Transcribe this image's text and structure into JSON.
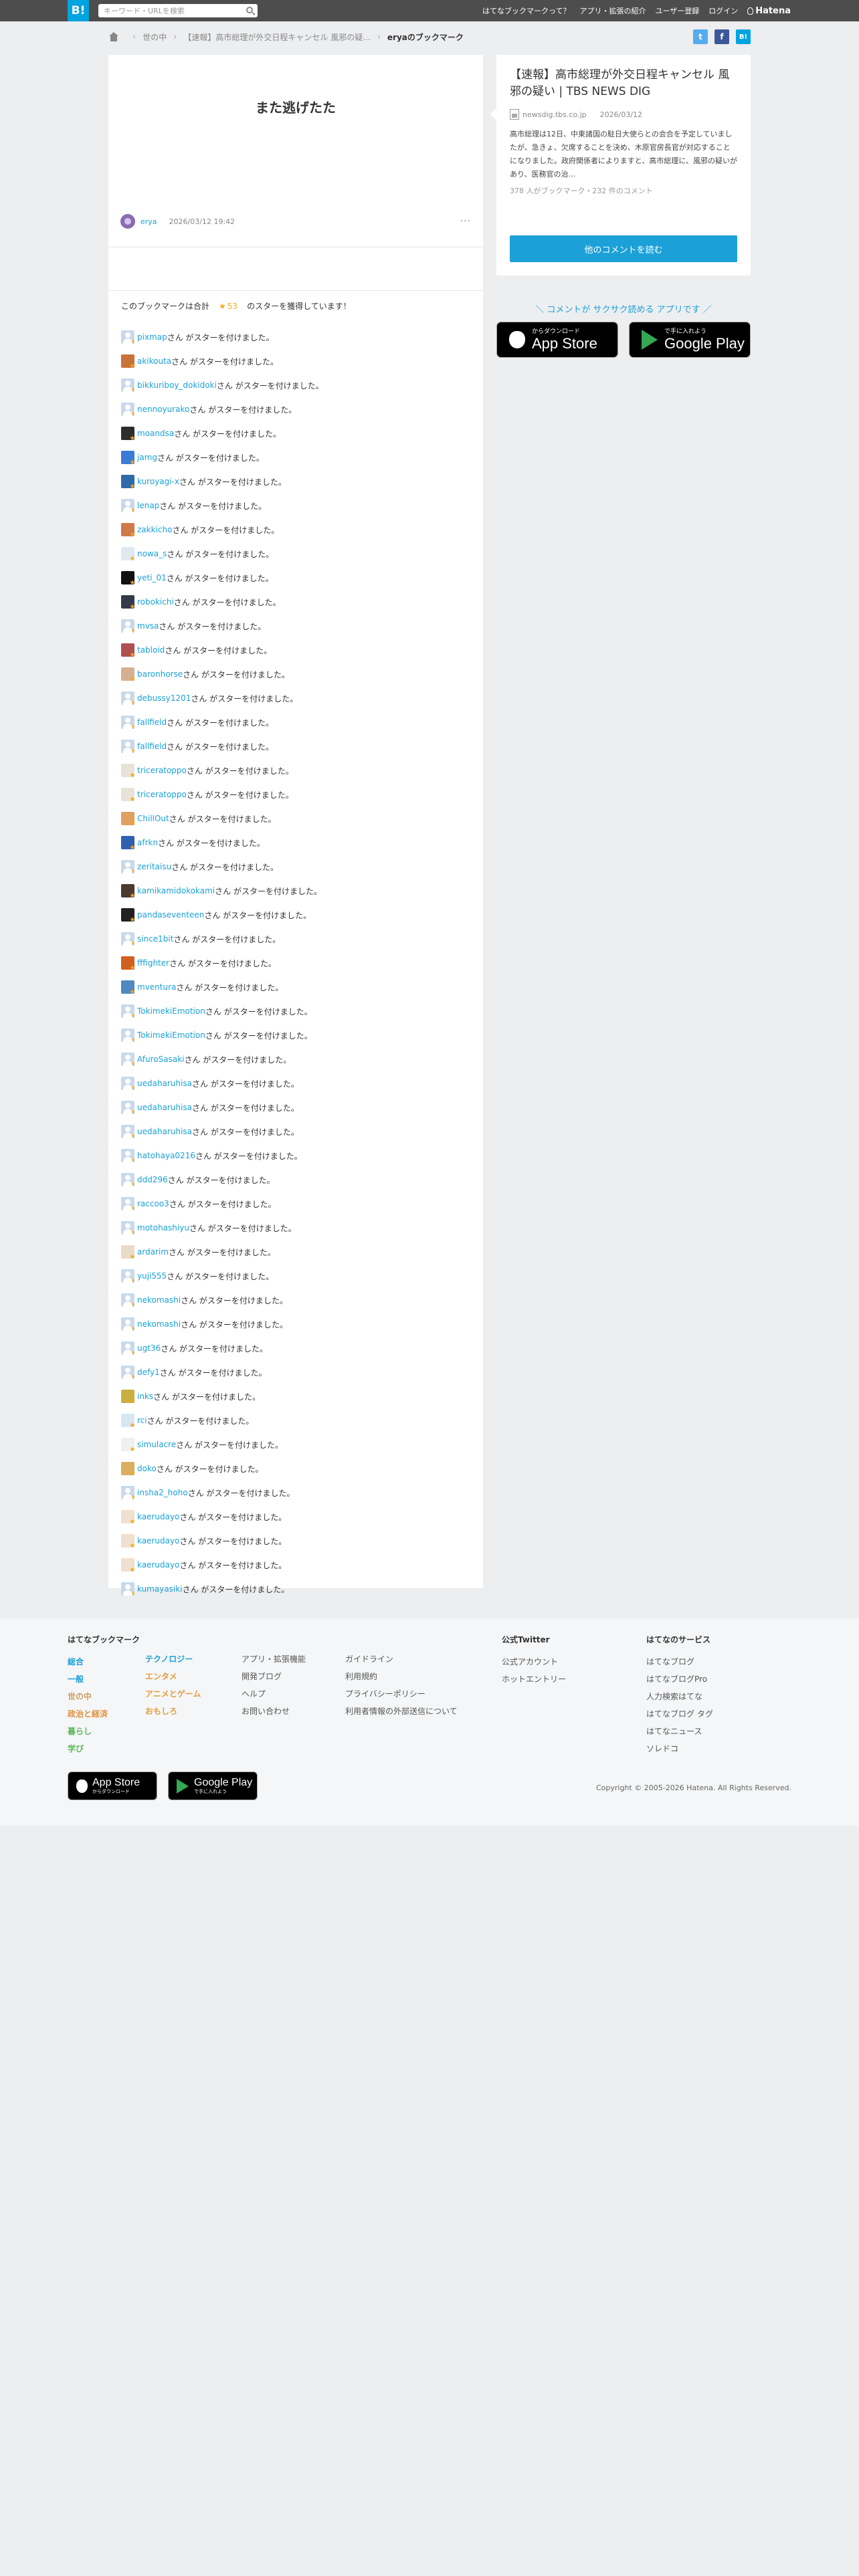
{
  "header": {
    "logo": "B!",
    "search_placeholder": "キーワード・URLを検索",
    "nav": [
      "はてなブックマークって？",
      "アプリ・拡張の紹介",
      "ユーザー登録",
      "ログイン"
    ],
    "brand": "Hatena"
  },
  "breadcrumb": {
    "items": [
      "世の中",
      "【速報】高市総理が外交日程キャンセル 風邪の疑..."
    ],
    "current": "eryaのブックマーク"
  },
  "share": {
    "twitter": "t",
    "facebook": "f",
    "hatena": "B!"
  },
  "entry": {
    "title": "また逃げたた",
    "user": "erya",
    "date": "2026/03/12 19:42",
    "more": "···"
  },
  "stars": {
    "summary_prefix": "このブックマークは合計",
    "star_glyph": "★",
    "count": "53",
    "summary_suffix": "のスターを獲得しています！",
    "suffix": "さん がスターを付けました。",
    "users": [
      {
        "name": "pixmap",
        "color": ""
      },
      {
        "name": "akikouta",
        "color": "#c8733a"
      },
      {
        "name": "bikkuriboy_dokidoki",
        "color": ""
      },
      {
        "name": "nennoyurako",
        "color": ""
      },
      {
        "name": "moandsa",
        "color": "#2d2d2d"
      },
      {
        "name": "jamg",
        "color": "#3a7bd5"
      },
      {
        "name": "kuroyagi-x",
        "color": "#2d6aa8"
      },
      {
        "name": "lenap",
        "color": ""
      },
      {
        "name": "zakkicho",
        "color": "#d07a4a"
      },
      {
        "name": "nowa_s",
        "color": "#e0e8f0"
      },
      {
        "name": "yeti_01",
        "color": "#111111"
      },
      {
        "name": "robokichi",
        "color": "#333b4a"
      },
      {
        "name": "mvsa",
        "color": ""
      },
      {
        "name": "tabloid",
        "color": "#b05050"
      },
      {
        "name": "baronhorse",
        "color": "#d4b090"
      },
      {
        "name": "debussy1201",
        "color": ""
      },
      {
        "name": "fallfield",
        "color": ""
      },
      {
        "name": "fallfield",
        "color": ""
      },
      {
        "name": "triceratoppo",
        "color": "#e8e2d8"
      },
      {
        "name": "triceratoppo",
        "color": "#e8e2d8"
      },
      {
        "name": "ChillOut",
        "color": "#e0a060"
      },
      {
        "name": "afrkn",
        "color": "#3060b0"
      },
      {
        "name": "zeritaisu",
        "color": ""
      },
      {
        "name": "kamikamidokokami",
        "color": "#4a3a30"
      },
      {
        "name": "pandaseventeen",
        "color": "#222222"
      },
      {
        "name": "since1bit",
        "color": ""
      },
      {
        "name": "fffighter",
        "color": "#d06020"
      },
      {
        "name": "mventura",
        "color": "#5088c0"
      },
      {
        "name": "TokimekiEmotion",
        "color": ""
      },
      {
        "name": "TokimekiEmotion",
        "color": ""
      },
      {
        "name": "AfuroSasaki",
        "color": ""
      },
      {
        "name": "uedaharuhisa",
        "color": ""
      },
      {
        "name": "uedaharuhisa",
        "color": ""
      },
      {
        "name": "uedaharuhisa",
        "color": ""
      },
      {
        "name": "hatohaya0216",
        "color": ""
      },
      {
        "name": "ddd296",
        "color": ""
      },
      {
        "name": "raccoo3",
        "color": ""
      },
      {
        "name": "motohashiyu",
        "color": ""
      },
      {
        "name": "ardarim",
        "color": "#e6dcc8"
      },
      {
        "name": "yuji555",
        "color": ""
      },
      {
        "name": "nekomashi",
        "color": ""
      },
      {
        "name": "nekomashi",
        "color": ""
      },
      {
        "name": "ugt36",
        "color": ""
      },
      {
        "name": "defy1",
        "color": ""
      },
      {
        "name": "inks",
        "color": "#c8b040"
      },
      {
        "name": "rci",
        "color": "#d8e6f0"
      },
      {
        "name": "simulacre",
        "color": "#f0f0f0"
      },
      {
        "name": "doko",
        "color": "#d8b060"
      },
      {
        "name": "insha2_hoho",
        "color": ""
      },
      {
        "name": "kaerudayo",
        "color": "#f0e0d0"
      },
      {
        "name": "kaerudayo",
        "color": "#f0e0d0"
      },
      {
        "name": "kaerudayo",
        "color": "#f0e0d0"
      },
      {
        "name": "kumayasiki",
        "color": ""
      }
    ]
  },
  "sidebar": {
    "title": "【速報】高市総理が外交日程キャンセル 風邪の疑い | TBS NEWS DIG",
    "source": "newsdig.tbs.co.jp",
    "date": "2026/03/12",
    "description": "高市総理は12日、中東諸国の駐日大使らとの会合を予定していましたが、急きょ、欠席することを決め、木原官房長官が対応することになりました。政府関係者によりますと、高市総理に、風邪の疑いがあり、医務官の治...",
    "meta": "378 人がブックマーク・232 件のコメント",
    "button": "他のコメントを読む",
    "promo": "＼ コメントが サクサク読める アプリです ／",
    "appstore_small": "からダウンロード",
    "appstore_big": "App Store",
    "googleplay_small": "で手に入れよう",
    "googleplay_big": "Google Play"
  },
  "footer": {
    "bookmark_heading": "はてなブックマーク",
    "cat_col1": [
      {
        "label": "総合",
        "color": "#1ba1d8"
      },
      {
        "label": "一般",
        "color": "#1ba1d8"
      },
      {
        "label": "世の中",
        "color": "#c8a060"
      },
      {
        "label": "政治と経済",
        "color": "#e09040"
      },
      {
        "label": "暮らし",
        "color": "#5cb85c"
      },
      {
        "label": "学び",
        "color": "#5cb85c"
      }
    ],
    "cat_col2": [
      {
        "label": "テクノロジー",
        "color": "#1ba1d8"
      },
      {
        "label": "エンタメ",
        "color": "#e0a040"
      },
      {
        "label": "アニメとゲーム",
        "color": "#e0a040"
      },
      {
        "label": "おもしろ",
        "color": "#e0a040"
      }
    ],
    "links_col3": [
      "アプリ・拡張機能",
      "開発ブログ",
      "ヘルプ",
      "お問い合わせ"
    ],
    "links_col4": [
      "ガイドライン",
      "利用規約",
      "プライバシーポリシー",
      "利用者情報の外部送信について"
    ],
    "twitter_heading": "公式Twitter",
    "twitter_links": [
      "公式アカウント",
      "ホットエントリー"
    ],
    "services_heading": "はてなのサービス",
    "services_links": [
      "はてなブログ",
      "はてなブログPro",
      "人力検索はてな",
      "はてなブログ タグ",
      "はてなニュース",
      "ソレドコ"
    ],
    "appstore_big": "App Store",
    "appstore_small": "からダウンロード",
    "googleplay_big": "Google Play",
    "googleplay_small": "で手に入れよう",
    "copyright": "Copyright © 2005-2026 Hatena. All Rights Reserved."
  }
}
